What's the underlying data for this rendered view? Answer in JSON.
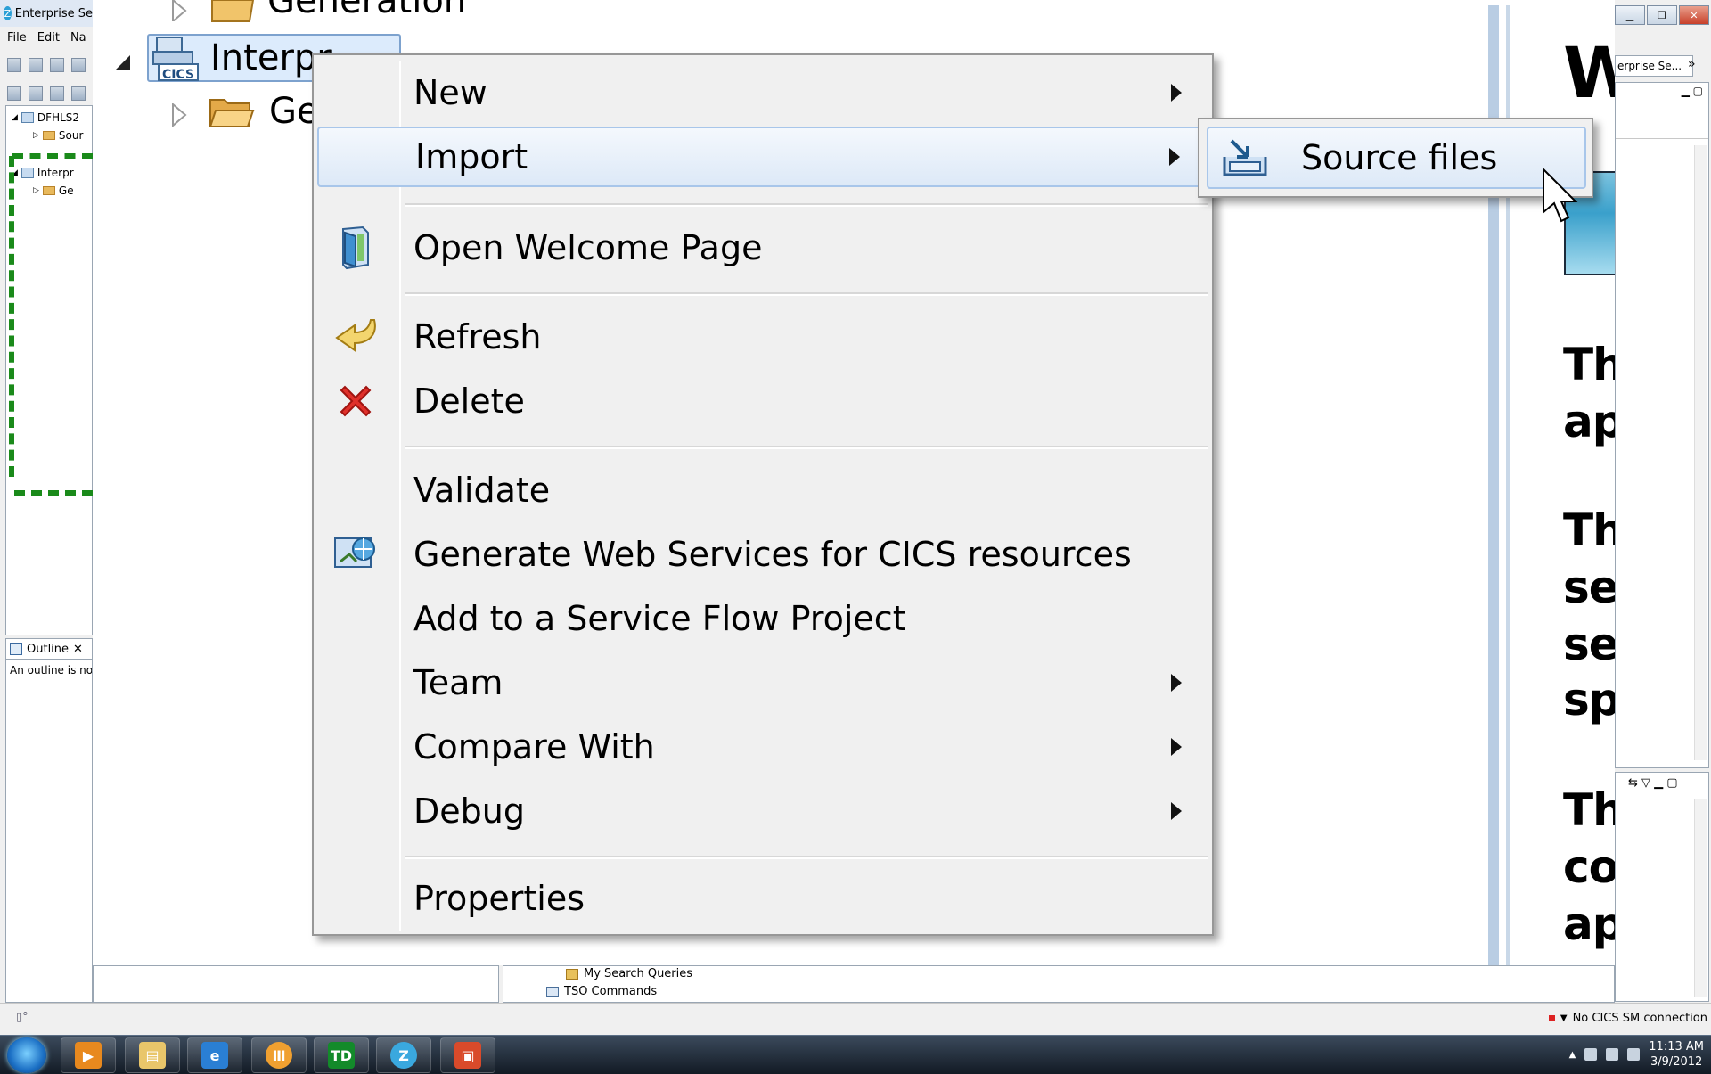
{
  "window": {
    "title": "Enterprise Se",
    "menu": [
      "File",
      "Edit",
      "Na"
    ]
  },
  "explorer_small": {
    "items": [
      {
        "label": "DFHLS2"
      },
      {
        "label": "Sour"
      },
      {
        "label": "Interpr"
      },
      {
        "label": "Ge"
      }
    ]
  },
  "outline": {
    "tab_label": "Outline",
    "message": "An outline is no"
  },
  "tree": {
    "top_folder": "Generation",
    "project": "Interpr",
    "child_folder": "Ge"
  },
  "context_menu": {
    "items": [
      {
        "label": "New",
        "submenu": true
      },
      {
        "label": "Import",
        "submenu": true
      },
      {
        "label": "Open Welcome Page"
      },
      {
        "label": "Refresh"
      },
      {
        "label": "Delete"
      },
      {
        "label": "Validate"
      },
      {
        "label": "Generate Web Services for CICS resources"
      },
      {
        "label": "Add to a Service Flow Project"
      },
      {
        "label": "Team",
        "submenu": true
      },
      {
        "label": "Compare With",
        "submenu": true
      },
      {
        "label": "Debug",
        "submenu": true
      },
      {
        "label": "Properties"
      }
    ]
  },
  "import_submenu": {
    "items": [
      {
        "label": "Source files"
      }
    ]
  },
  "welcome_panel": {
    "heading": "W",
    "lines": [
      "Th",
      "ap",
      "Th",
      "se",
      "se",
      "sp",
      "Th",
      "co",
      "ap"
    ]
  },
  "perspective": {
    "label": "erprise Se..."
  },
  "bottom_panel": {
    "items": [
      "My Search Queries",
      "TSO Commands"
    ]
  },
  "status": {
    "connection": "No CICS SM connection"
  },
  "taskbar": {
    "clock_time": "11:13 AM",
    "clock_date": "3/9/2012"
  },
  "colors": {
    "selection": "#dcebfc",
    "menu_bg": "#f0f0f0",
    "folder": "#e8b95c",
    "delete_red": "#e0302a"
  }
}
